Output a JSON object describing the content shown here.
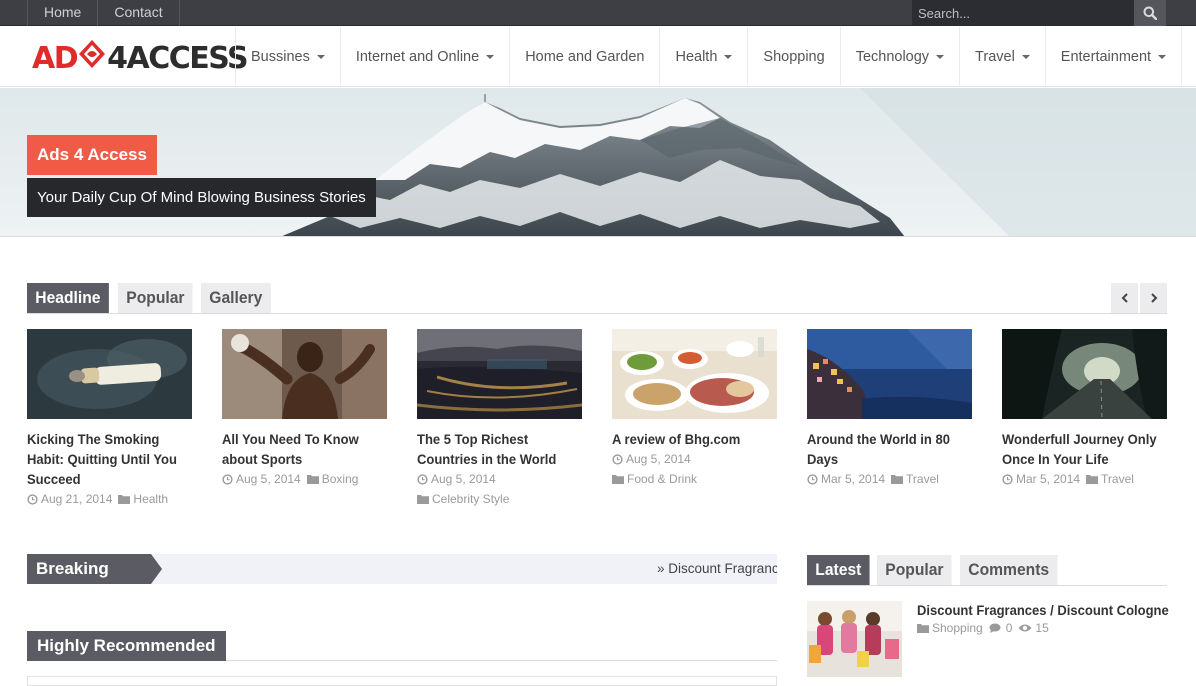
{
  "topbar": {
    "links": [
      "Home",
      "Contact"
    ],
    "search_placeholder": "Search..."
  },
  "logo": {
    "part1": "AD",
    "part2": "4ACCESS"
  },
  "nav": [
    {
      "label": "Bussines",
      "dropdown": true
    },
    {
      "label": "Internet and Online",
      "dropdown": true
    },
    {
      "label": "Home and Garden",
      "dropdown": false
    },
    {
      "label": "Health",
      "dropdown": true
    },
    {
      "label": "Shopping",
      "dropdown": false
    },
    {
      "label": "Technology",
      "dropdown": true
    },
    {
      "label": "Travel",
      "dropdown": true
    },
    {
      "label": "Entertainment",
      "dropdown": true
    }
  ],
  "hero": {
    "badge": "Ads 4 Access",
    "tagline": "Your Daily Cup Of Mind Blowing Business Stories"
  },
  "tabs": {
    "items": [
      "Headline",
      "Popular",
      "Gallery"
    ],
    "active": "Headline"
  },
  "posts": [
    {
      "title": "Kicking The Smoking Habit: Quitting Until You Succeed",
      "date": "Aug 21, 2014",
      "category": "Health",
      "thumb": "smoking"
    },
    {
      "title": "All You Need To Know about Sports",
      "date": "Aug 5, 2014",
      "category": "Boxing",
      "thumb": "sports"
    },
    {
      "title": "The 5 Top Richest Countries in the World",
      "date": "Aug 5, 2014",
      "category": "Celebrity Style",
      "thumb": "city"
    },
    {
      "title": "A review of Bhg.com",
      "date": "Aug 5, 2014",
      "category": "Food & Drink",
      "thumb": "food"
    },
    {
      "title": "Around the World in 80 Days",
      "date": "Mar 5, 2014",
      "category": "Travel",
      "thumb": "coast"
    },
    {
      "title": "Wonderfull Journey Only Once In Your Life",
      "date": "Mar 5, 2014",
      "category": "Travel",
      "thumb": "road"
    }
  ],
  "breaking": {
    "label": "Breaking News",
    "ticker": "Discount Fragrances / Discount Cologne"
  },
  "recommended": {
    "label": "Highly Recommended"
  },
  "sidebar": {
    "tabs": [
      "Latest",
      "Popular",
      "Comments"
    ],
    "active": "Latest",
    "post": {
      "title": "Discount Fragrances / Discount Cologne",
      "category": "Shopping",
      "comments": "0",
      "views": "15"
    }
  },
  "colors": {
    "accent": "#f05b47",
    "dark": "#27282c",
    "tab_active": "#5b5c63",
    "topbar": "#3e3f45",
    "logo_red": "#e02b2b"
  }
}
